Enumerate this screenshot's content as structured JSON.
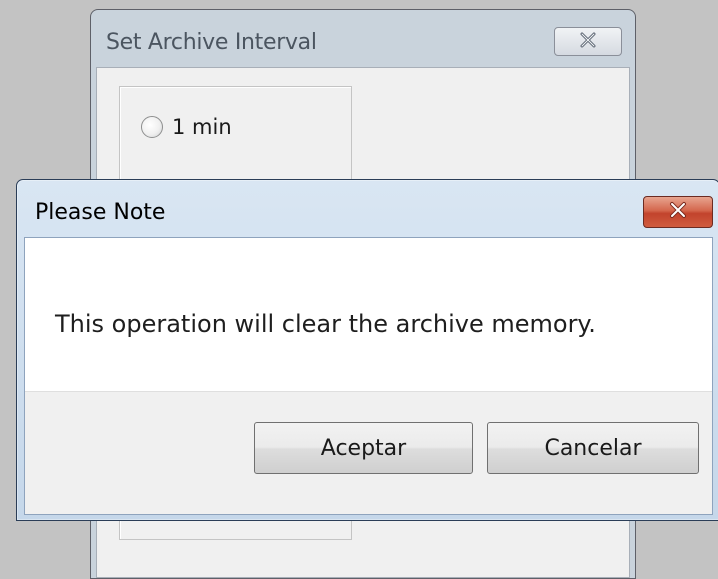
{
  "background_dialog": {
    "title": "Set Archive Interval",
    "close_icon": "close-icon",
    "radio_option": {
      "label": "1 min",
      "checked": false
    }
  },
  "dialog": {
    "title": "Please Note",
    "close_icon": "close-icon",
    "message": "This operation will clear the archive memory.",
    "ok_label": "Aceptar",
    "cancel_label": "Cancelar"
  },
  "colors": {
    "desktop": "#c3c3c3",
    "dialog_title_bar": "#c5d7ea",
    "close_button_red": "#c2432c"
  }
}
